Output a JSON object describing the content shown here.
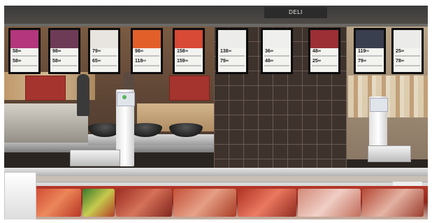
{
  "signage": {
    "section_sign": "DELI"
  },
  "price_screens": [
    {
      "top_price": "58",
      "top_cents": "88",
      "bottom_price": "58",
      "bottom_cents": "88",
      "image_color": "#b4367d"
    },
    {
      "top_price": "98",
      "top_cents": "88",
      "bottom_price": "58",
      "bottom_cents": "88",
      "image_color": "#6e3b56"
    },
    {
      "top_price": "79",
      "top_cents": "90",
      "bottom_price": "65",
      "bottom_cents": "00",
      "image_color": "#e8e4df"
    },
    {
      "top_price": "98",
      "top_cents": "80",
      "bottom_price": "118",
      "bottom_cents": "00",
      "image_color": "#e35f2a"
    },
    {
      "top_price": "158",
      "top_cents": "00",
      "bottom_price": "159",
      "bottom_cents": "00",
      "image_color": "#d84936"
    },
    {
      "top_price": "138",
      "top_cents": "00",
      "bottom_price": "79",
      "bottom_cents": "80",
      "image_color": "#ececea"
    },
    {
      "top_price": "36",
      "top_cents": "80",
      "bottom_price": "48",
      "bottom_cents": "80",
      "image_color": "#efefed"
    },
    {
      "top_price": "48",
      "top_cents": "80",
      "bottom_price": "25",
      "bottom_cents": "80",
      "image_color": "#9c2f35"
    },
    {
      "top_price": "119",
      "top_cents": "00",
      "bottom_price": "79",
      "bottom_cents": "80",
      "image_color": "#3a3f4f"
    },
    {
      "top_price": "25",
      "top_cents": "80",
      "bottom_price": "78",
      "bottom_cents": "80",
      "image_color": "#ebebea"
    }
  ]
}
